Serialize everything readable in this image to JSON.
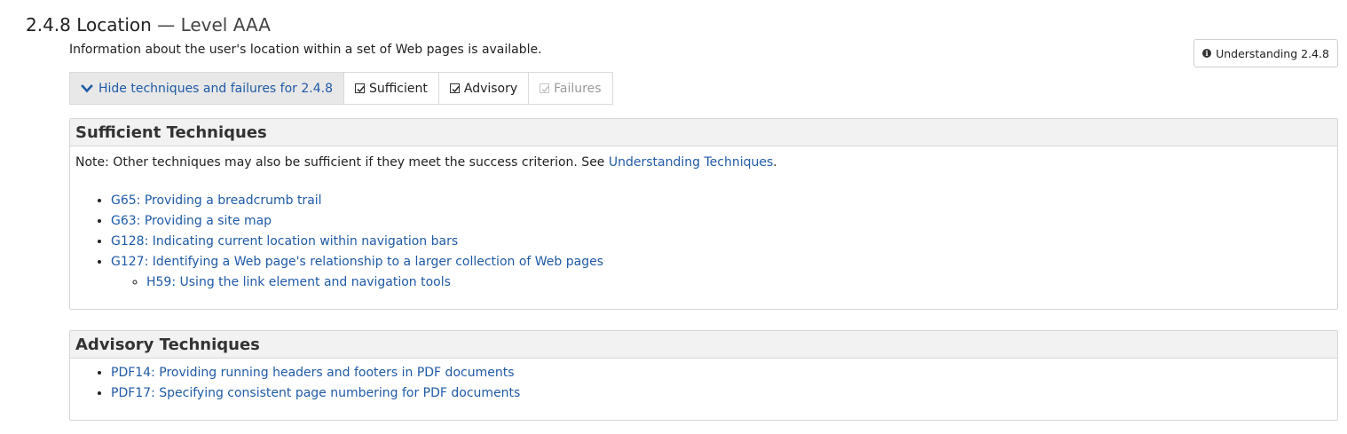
{
  "criterion": {
    "number": "2.4.8",
    "name": "Location",
    "separator": " — ",
    "level": "Level AAA",
    "description": "Information about the user's location within a set of Web pages is available."
  },
  "understanding_button": {
    "label": "Understanding 2.4.8",
    "icon": "info-icon"
  },
  "toolbar": {
    "toggle_label": "Hide techniques and failures for 2.4.8",
    "toggle_icon": "chevron-down-icon",
    "filters": [
      {
        "label": "Sufficient",
        "checked": true,
        "disabled": false
      },
      {
        "label": "Advisory",
        "checked": true,
        "disabled": false
      },
      {
        "label": "Failures",
        "checked": true,
        "disabled": true
      }
    ]
  },
  "sufficient": {
    "title": "Sufficient Techniques",
    "note_prefix": "Note: Other techniques may also be sufficient if they meet the success criterion. See ",
    "note_link": "Understanding Techniques",
    "note_suffix": ".",
    "items": [
      "G65: Providing a breadcrumb trail",
      "G63: Providing a site map",
      "G128: Indicating current location within navigation bars",
      "G127: Identifying a Web page's relationship to a larger collection of Web pages"
    ],
    "subitems": [
      "H59: Using the link element and navigation tools"
    ]
  },
  "advisory": {
    "title": "Advisory Techniques",
    "items": [
      "PDF14: Providing running headers and footers in PDF documents",
      "PDF17: Specifying consistent page numbering for PDF documents"
    ]
  },
  "colors": {
    "link": "#1f5aa6",
    "panel_header": "#f2f2f2",
    "toolbar_toggle_bg": "#e8e8e8"
  }
}
